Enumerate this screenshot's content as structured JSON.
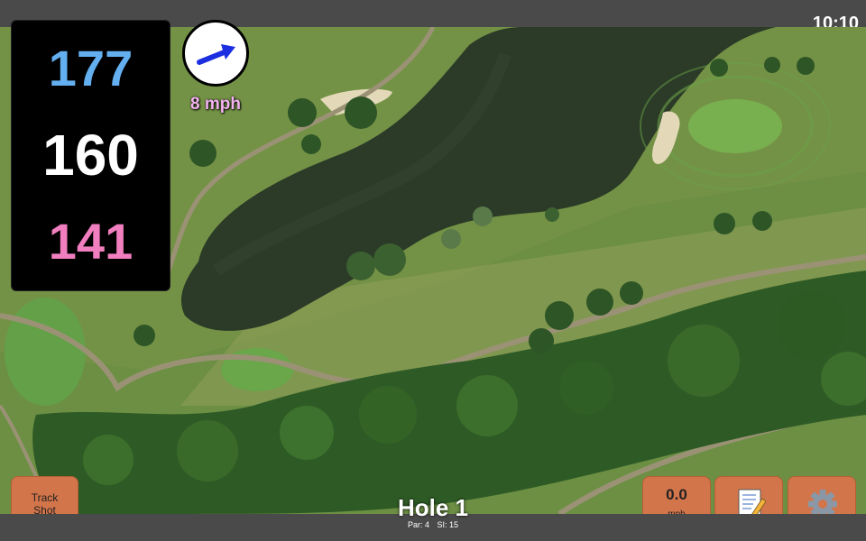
{
  "status_bar": {
    "time": "10:10"
  },
  "distances": {
    "back": {
      "value": "177",
      "color": "#63aff0"
    },
    "middle": {
      "value": "160",
      "color": "#ffffff"
    },
    "front": {
      "value": "141",
      "color": "#f17fbf"
    }
  },
  "wind": {
    "speed_label": "8 mph",
    "arrow_icon": "wind-direction-arrow-icon",
    "arrow_color": "#1b2fe0",
    "label_color": "#f2b2ee"
  },
  "buttons": {
    "track_shot": {
      "line1": "Track",
      "line2": "Shot"
    },
    "wind_speed": {
      "value": "0.0",
      "unit": "mph"
    },
    "notes_icon": "notepad-icon",
    "settings_icon": "gear-icon",
    "accent": "#d2754a"
  },
  "hole": {
    "title": "Hole 1",
    "par": "Par: 4",
    "stroke_index": "SI: 15"
  },
  "map": {
    "fairway_color": "#5d8a3a",
    "water_color": "#2a3a26",
    "trees_color": "#2d5a25",
    "rough_color": "#8a8a55"
  }
}
